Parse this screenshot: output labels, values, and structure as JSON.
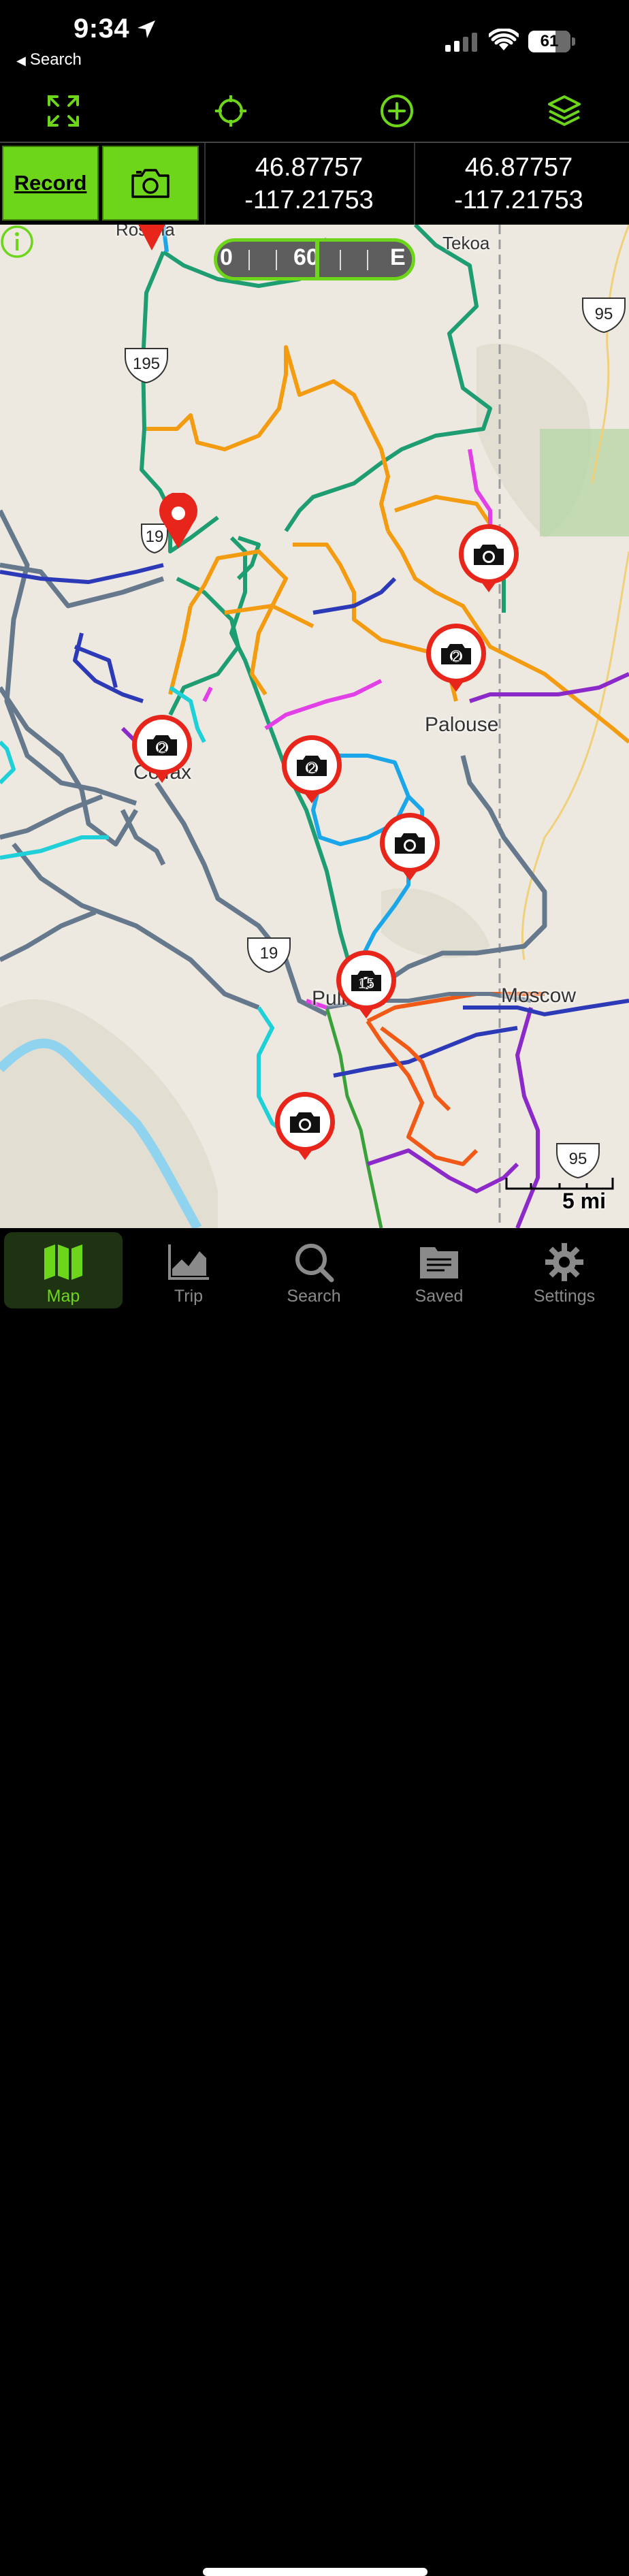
{
  "status_bar": {
    "time": "9:34",
    "back_label": "Search",
    "battery": "61"
  },
  "toolbar": {
    "icons": [
      "expand-icon",
      "locate-icon",
      "add-icon",
      "layers-icon"
    ]
  },
  "info_row": {
    "record_label": "Record",
    "camera_icon": "camera-icon",
    "coord_1": {
      "lat": "46.87757",
      "lon": "-117.21753"
    },
    "coord_2": {
      "lat": "46.87757",
      "lon": "-117.21753"
    }
  },
  "map": {
    "compass": {
      "left": "0",
      "mid": "60",
      "right": "E"
    },
    "labels": {
      "genesee": "Tekoa",
      "palouse": "Palouse",
      "colfax": "Colfax",
      "pullman": "Pullman",
      "moscow": "Moscow",
      "top_left": "Rosalia"
    },
    "highways": {
      "hw195_top": "195",
      "hw95_top": "95",
      "hw95_bottom": "95",
      "hw195_mid": "19",
      "hw195_bottom": "19"
    },
    "photo_counts": [
      "",
      "2",
      "2",
      "2",
      "",
      "15",
      ""
    ],
    "scale": "5 mi"
  },
  "colors": {
    "accent": "#6ed61a",
    "pin_red": "#e8251a"
  },
  "tabs": [
    {
      "label": "Map",
      "icon": "map-icon",
      "active": true
    },
    {
      "label": "Trip",
      "icon": "chart-icon",
      "active": false
    },
    {
      "label": "Search",
      "icon": "search-icon",
      "active": false
    },
    {
      "label": "Saved",
      "icon": "folder-icon",
      "active": false
    },
    {
      "label": "Settings",
      "icon": "gear-icon",
      "active": false
    }
  ]
}
